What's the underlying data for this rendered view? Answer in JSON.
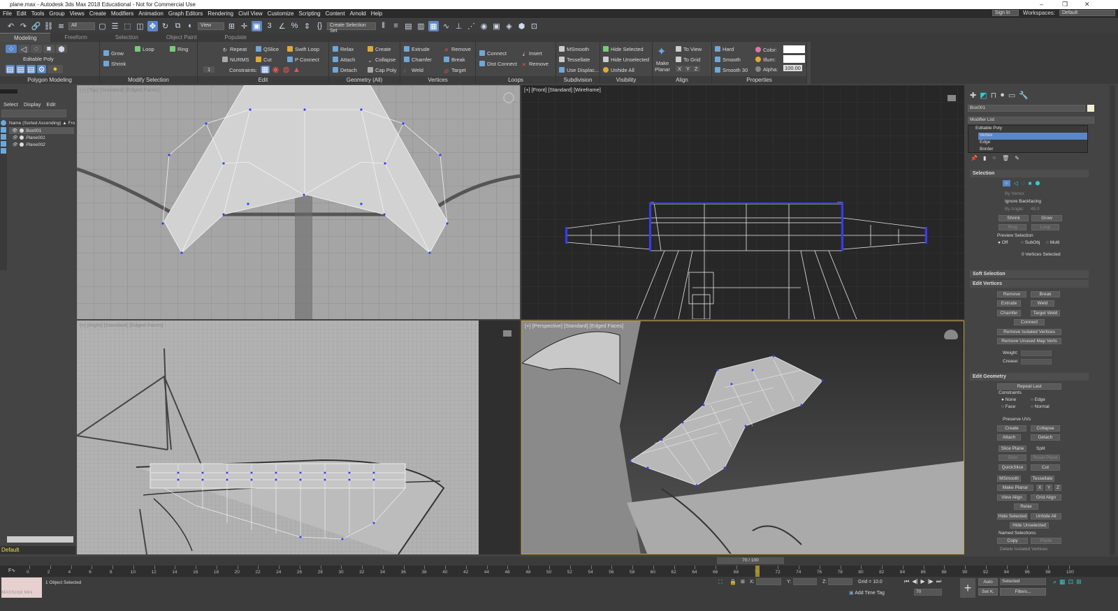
{
  "title": "plane.max - Autodesk 3ds Max 2018 Educational - Not for Commercial Use",
  "window_controls": [
    "–",
    "❐",
    "✕"
  ],
  "menu": [
    "File",
    "Edit",
    "Tools",
    "Group",
    "Views",
    "Create",
    "Modifiers",
    "Animation",
    "Graph Editors",
    "Rendering",
    "Civil View",
    "Customize",
    "Scripting",
    "Content",
    "Arnold",
    "Help"
  ],
  "signin": "Sign In",
  "workspaces_label": "Workspaces:",
  "workspace": "Default",
  "toolbar": {
    "filter": "All",
    "refcoord": "View",
    "selection_set": "Create Selection Set"
  },
  "ribbon_tabs": [
    "Modeling",
    "Freeform",
    "Selection",
    "Object Paint",
    "Populate"
  ],
  "ribbon": {
    "polygon_modeling": {
      "title": "Polygon Modeling",
      "label": "Editable Poly"
    },
    "modify_selection": {
      "title": "Modify Selection",
      "grow": "Grow",
      "shrink": "Shrink",
      "loop": "Loop",
      "ring": "Ring"
    },
    "edit": {
      "title": "Edit",
      "repeat": "Repeat",
      "qslice": "QSlice",
      "swift_loop": "Swift Loop",
      "nurms": "NURMS",
      "cut": "Cut",
      "p_connect": "P Connect",
      "constraints": "Constraints:",
      "spinner": "1"
    },
    "geometry": {
      "title": "Geometry (All)",
      "relax": "Relax",
      "create": "Create",
      "attach": "Attach",
      "collapse": "Collapse",
      "detach": "Detach",
      "cap_poly": "Cap Poly"
    },
    "vertices": {
      "title": "Vertices",
      "extrude": "Extrude",
      "remove": "Remove",
      "chamfer": "Chamfer",
      "break": "Break",
      "weld": "Weld",
      "target": "Target"
    },
    "loops": {
      "title": "Loops",
      "connect": "Connect",
      "insert": "Insert",
      "dist_connect": "Dist Connect",
      "remove": "Remove"
    },
    "subdivision": {
      "title": "Subdivision",
      "msmooth": "MSmooth",
      "tessellate": "Tessellate",
      "use_displac": "Use Displac..."
    },
    "visibility": {
      "title": "Visibility",
      "hide_selected": "Hide Selected",
      "hide_unselected": "Hide Unselected",
      "unhide_all": "Unhide All"
    },
    "align": {
      "title": "Align",
      "make_planar": "Make Planar",
      "to_view": "To View",
      "to_grid": "To Grid",
      "x": "X",
      "y": "Y",
      "z": "Z"
    },
    "properties": {
      "title": "Properties",
      "hard": "Hard",
      "smooth": "Smooth",
      "smooth30": "Smooth 30",
      "color": "Color:",
      "illum": "Illum:",
      "alpha": "Alpha:",
      "alpha_value": "100.00"
    }
  },
  "scene_explorer": {
    "tabs": [
      "Select",
      "Display",
      "Edit"
    ],
    "header": "Name (Sorted Ascending) ▲ Fro...",
    "objects": [
      "Box001",
      "Plane001",
      "Plane002"
    ],
    "layer": "Default"
  },
  "viewports": {
    "top": "[+] [Top] [Standard] [Edged Faces]",
    "front": "[+] [Front] [Standard] [Wireframe]",
    "right": "[+] [Right] [Standard] [Edged Faces]",
    "perspective": "[+] [Perspective] [Standard] [Edged Faces]"
  },
  "command_panel": {
    "object_name": "Box001",
    "modifier_list": "Modifier List",
    "stack": [
      "Editable Poly",
      "Vertex",
      "Edge",
      "Border"
    ],
    "selection": {
      "title": "Selection",
      "by_vertex": "By Vertex",
      "ignore_backfacing": "Ignore Backfacing",
      "by_angle": "By Angle:",
      "angle": "45.0",
      "shrink": "Shrink",
      "grow": "Grow",
      "ring": "Ring",
      "loop": "Loop",
      "preview": "Preview Selection",
      "off": "Off",
      "subobj": "SubObj",
      "multi": "Multi",
      "status": "0 Vertices Selected"
    },
    "soft_selection": "Soft Selection",
    "edit_vertices": {
      "title": "Edit Vertices",
      "remove": "Remove",
      "break": "Break",
      "extrude": "Extrude",
      "weld": "Weld",
      "chamfer": "Chamfer",
      "target_weld": "Target Weld",
      "connect": "Connect",
      "remove_isolated": "Remove Isolated Vertices",
      "remove_unused": "Remove Unused Map Verts",
      "weight": "Weight:",
      "crease": "Crease:"
    },
    "edit_geometry": {
      "title": "Edit Geometry",
      "repeat_last": "Repeat Last",
      "constraints": "Constraints",
      "none": "None",
      "edge": "Edge",
      "face": "Face",
      "normal": "Normal",
      "preserve_uvs": "Preserve UVs",
      "create": "Create",
      "collapse": "Collapse",
      "attach": "Attach",
      "detach": "Detach",
      "slice_plane": "Slice Plane",
      "split": "Split",
      "slice": "Slice",
      "reset_plane": "Reset Plane",
      "quickslice": "QuickSlice",
      "cut": "Cut",
      "msmooth": "MSmooth",
      "tessellate": "Tessellate",
      "make_planar": "Make Planar",
      "x": "X",
      "y": "Y",
      "z": "Z",
      "view_align": "View Align",
      "grid_align": "Grid Align",
      "relax": "Relax",
      "hide_selected": "Hide Selected",
      "unhide_all": "Unhide All",
      "hide_unselected": "Hide Unselected",
      "named_selections": "Named Selections:",
      "copy": "Copy",
      "paste": "Paste",
      "delete_isolated": "Delete Isolated Vertices"
    }
  },
  "timeline": {
    "frame": "70 / 100",
    "current": 70,
    "total": 100,
    "ticks": [
      0,
      2,
      4,
      6,
      8,
      10,
      12,
      14,
      16,
      18,
      20,
      22,
      24,
      26,
      28,
      30,
      32,
      34,
      36,
      38,
      40,
      42,
      44,
      46,
      48,
      50,
      52,
      54,
      56,
      58,
      60,
      62,
      64,
      66,
      68,
      70,
      72,
      74,
      76,
      78,
      80,
      82,
      84,
      86,
      88,
      90,
      92,
      94,
      96,
      98,
      100
    ]
  },
  "status": {
    "maxscript": "MAXScript Mini",
    "selected": "1 Object Selected",
    "x": "X:",
    "y": "Y:",
    "z": "Z:",
    "grid": "Grid = 10.0",
    "add_time_tag": "Add Time Tag",
    "auto": "Auto",
    "set_key": "Set K.",
    "key_mode": "Selected",
    "filters": "Filters...",
    "frame_value": "70"
  },
  "colors": {
    "accent": "#5b87c5",
    "vertex": "#3a3aff",
    "object_color": "#ffffff"
  }
}
